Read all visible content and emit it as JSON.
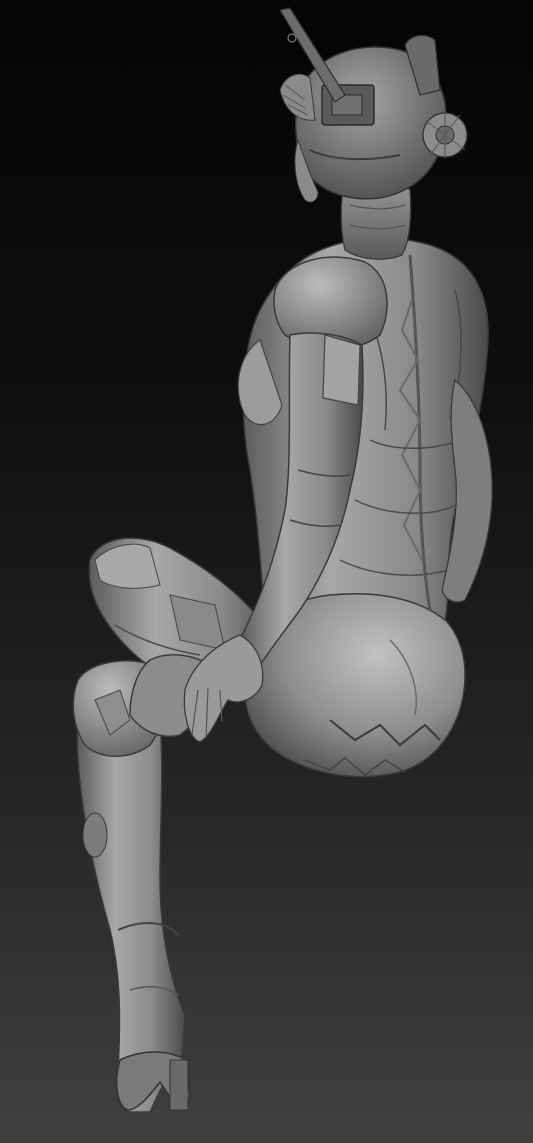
{
  "scene": {
    "subject": "sculpted-figure-render",
    "palette": {
      "background_top": "#060606",
      "background_bottom": "#3c3c3c",
      "clay_light": "#b4b4b4",
      "clay_mid": "#7e7e7e",
      "clay_dark": "#3a3a3a"
    }
  }
}
